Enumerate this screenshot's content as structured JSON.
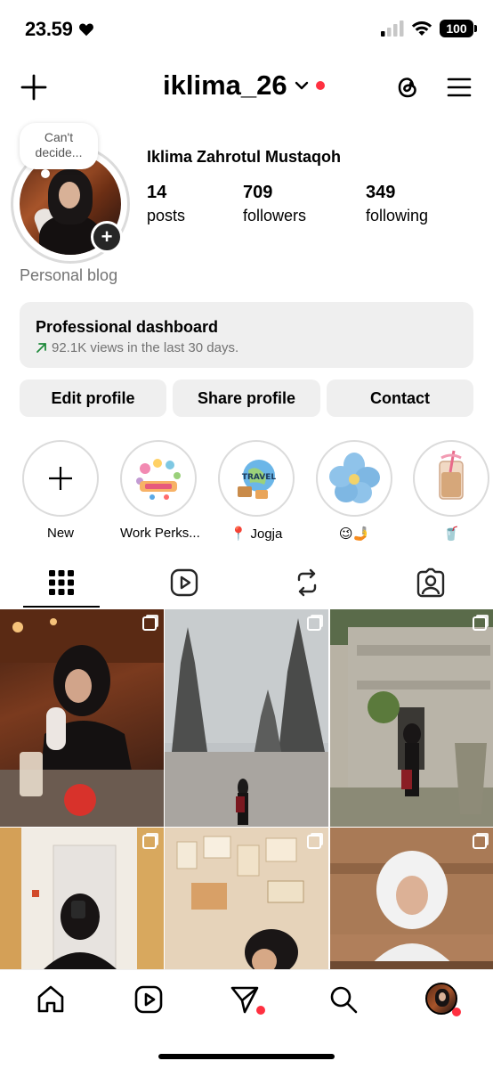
{
  "status_bar": {
    "time": "23.59",
    "battery": "100"
  },
  "header": {
    "username": "iklima_26",
    "create_icon": "plus-icon",
    "threads_icon": "threads-icon",
    "menu_icon": "hamburger-menu-icon"
  },
  "profile": {
    "note": "Can't decide...",
    "full_name": "Iklima Zahrotul Mustaqoh",
    "category": "Personal blog",
    "stats": [
      {
        "value": "14",
        "label": "posts"
      },
      {
        "value": "709",
        "label": "followers"
      },
      {
        "value": "349",
        "label": "following"
      }
    ]
  },
  "dashboard": {
    "title": "Professional dashboard",
    "subtitle": "92.1K views in the last 30 days.",
    "trend_color": "#1f8a3b"
  },
  "actions": {
    "edit": "Edit profile",
    "share": "Share profile",
    "contact": "Contact"
  },
  "highlights": [
    {
      "label": "New"
    },
    {
      "label": "Work Perks..."
    },
    {
      "label": "📍 Jogja"
    },
    {
      "label": "😉🤳"
    },
    {
      "label": "🥤"
    }
  ],
  "tabs": [
    "grid-icon",
    "reels-icon",
    "reposts-icon",
    "tagged-icon"
  ],
  "nav": [
    "home-icon",
    "reels-icon",
    "direct-message-icon",
    "search-icon",
    "profile-avatar"
  ],
  "colors": {
    "notification": "#ff3040",
    "button_bg": "#efefef",
    "muted_text": "#737373"
  }
}
